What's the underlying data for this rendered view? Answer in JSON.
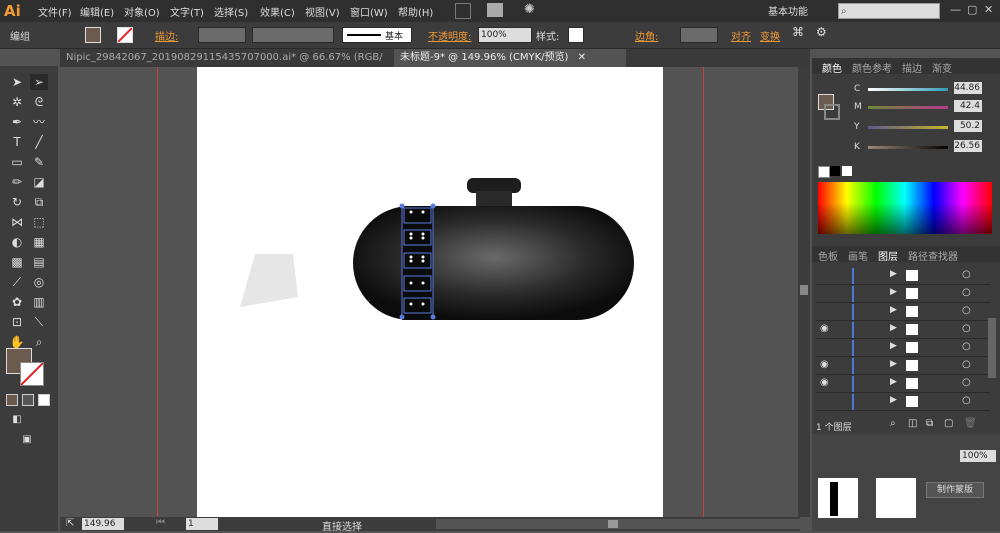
{
  "app": {
    "logo": "Ai"
  },
  "menu": [
    "文件(F)",
    "编辑(E)",
    "对象(O)",
    "文字(T)",
    "选择(S)",
    "效果(C)",
    "视图(V)",
    "窗口(W)",
    "帮助(H)"
  ],
  "workspace": "基本功能",
  "window_controls": [
    "—",
    "▢",
    "✕"
  ],
  "control": {
    "group_label": "编组",
    "stroke_label": "描边:",
    "brush_label": "基本",
    "opacity_label": "不透明度:",
    "opacity_value": "100%",
    "style_label": "样式:",
    "corner_label": "边角:",
    "align_label": "对齐",
    "transform_label": "变换"
  },
  "tabs": [
    {
      "label": "Nipic_29842067_20190829115435707000.ai* @ 66.67% (RGB/预览)",
      "close": "✕"
    },
    {
      "label": "未标题-9* @ 149.96% (CMYK/预览)",
      "close": "✕"
    }
  ],
  "color_panel": {
    "tabs": [
      "颜色",
      "颜色参考",
      "描边",
      "渐变"
    ],
    "channels": [
      {
        "name": "C",
        "value": "44.86",
        "color": "#2d9bb5"
      },
      {
        "name": "M",
        "value": "42.4",
        "color": "#b8388b"
      },
      {
        "name": "Y",
        "value": "50.2",
        "color": "#c5b52a"
      },
      {
        "name": "K",
        "value": "26.56",
        "color": "#555555"
      }
    ],
    "fill_color": "#6b5a4d"
  },
  "layers_panel": {
    "tabs": [
      "色板",
      "画笔",
      "图层",
      "路径查找器"
    ],
    "footer": "1 个图层",
    "rows": [
      {
        "eye": false
      },
      {
        "eye": false
      },
      {
        "eye": false
      },
      {
        "eye": true
      },
      {
        "eye": false
      },
      {
        "eye": true
      },
      {
        "eye": true
      },
      {
        "eye": false
      }
    ]
  },
  "bottom_panel": {
    "opacity_value": "100%",
    "make_mask": "制作蒙版"
  },
  "status": {
    "zoom": "149.96",
    "page": "1",
    "tool": "直接选择"
  },
  "tool_colors": {
    "fill": "#6b5a4d",
    "accent": "#f29a34"
  }
}
